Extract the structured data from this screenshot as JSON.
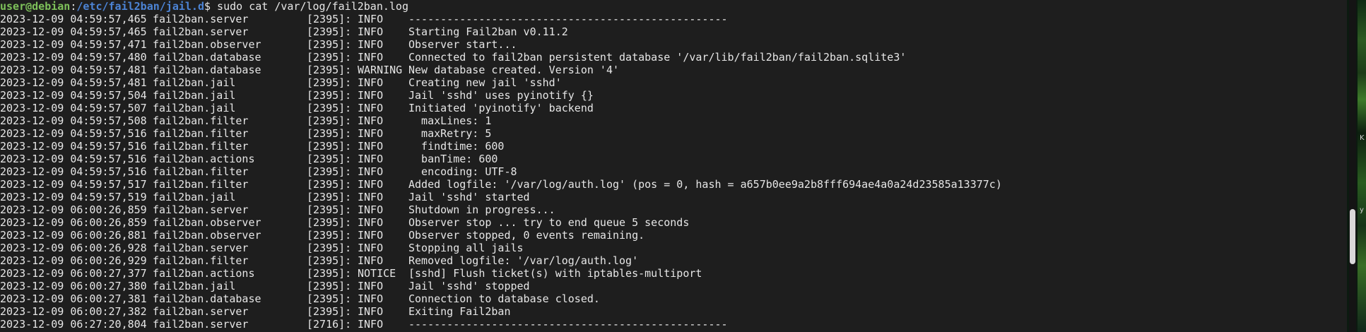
{
  "prompt": {
    "user": "user@debian",
    "separator": ":",
    "path": "/etc/fail2ban/jail.d",
    "dollar": "$",
    "command": " sudo cat /var/log/fail2ban.log"
  },
  "log": [
    {
      "ts": "2023-12-09 04:59:57,465",
      "logger": "fail2ban.server",
      "pid": "[2395]:",
      "level": "INFO",
      "msg": "--------------------------------------------------"
    },
    {
      "ts": "2023-12-09 04:59:57,465",
      "logger": "fail2ban.server",
      "pid": "[2395]:",
      "level": "INFO",
      "msg": "Starting Fail2ban v0.11.2"
    },
    {
      "ts": "2023-12-09 04:59:57,471",
      "logger": "fail2ban.observer",
      "pid": "[2395]:",
      "level": "INFO",
      "msg": "Observer start..."
    },
    {
      "ts": "2023-12-09 04:59:57,480",
      "logger": "fail2ban.database",
      "pid": "[2395]:",
      "level": "INFO",
      "msg": "Connected to fail2ban persistent database '/var/lib/fail2ban/fail2ban.sqlite3'"
    },
    {
      "ts": "2023-12-09 04:59:57,481",
      "logger": "fail2ban.database",
      "pid": "[2395]:",
      "level": "WARNING",
      "msg": "New database created. Version '4'"
    },
    {
      "ts": "2023-12-09 04:59:57,481",
      "logger": "fail2ban.jail",
      "pid": "[2395]:",
      "level": "INFO",
      "msg": "Creating new jail 'sshd'"
    },
    {
      "ts": "2023-12-09 04:59:57,504",
      "logger": "fail2ban.jail",
      "pid": "[2395]:",
      "level": "INFO",
      "msg": "Jail 'sshd' uses pyinotify {}"
    },
    {
      "ts": "2023-12-09 04:59:57,507",
      "logger": "fail2ban.jail",
      "pid": "[2395]:",
      "level": "INFO",
      "msg": "Initiated 'pyinotify' backend"
    },
    {
      "ts": "2023-12-09 04:59:57,508",
      "logger": "fail2ban.filter",
      "pid": "[2395]:",
      "level": "INFO",
      "msg": "  maxLines: 1"
    },
    {
      "ts": "2023-12-09 04:59:57,516",
      "logger": "fail2ban.filter",
      "pid": "[2395]:",
      "level": "INFO",
      "msg": "  maxRetry: 5"
    },
    {
      "ts": "2023-12-09 04:59:57,516",
      "logger": "fail2ban.filter",
      "pid": "[2395]:",
      "level": "INFO",
      "msg": "  findtime: 600"
    },
    {
      "ts": "2023-12-09 04:59:57,516",
      "logger": "fail2ban.actions",
      "pid": "[2395]:",
      "level": "INFO",
      "msg": "  banTime: 600"
    },
    {
      "ts": "2023-12-09 04:59:57,516",
      "logger": "fail2ban.filter",
      "pid": "[2395]:",
      "level": "INFO",
      "msg": "  encoding: UTF-8"
    },
    {
      "ts": "2023-12-09 04:59:57,517",
      "logger": "fail2ban.filter",
      "pid": "[2395]:",
      "level": "INFO",
      "msg": "Added logfile: '/var/log/auth.log' (pos = 0, hash = a657b0ee9a2b8fff694ae4a0a24d23585a13377c)"
    },
    {
      "ts": "2023-12-09 04:59:57,519",
      "logger": "fail2ban.jail",
      "pid": "[2395]:",
      "level": "INFO",
      "msg": "Jail 'sshd' started"
    },
    {
      "ts": "2023-12-09 06:00:26,859",
      "logger": "fail2ban.server",
      "pid": "[2395]:",
      "level": "INFO",
      "msg": "Shutdown in progress..."
    },
    {
      "ts": "2023-12-09 06:00:26,859",
      "logger": "fail2ban.observer",
      "pid": "[2395]:",
      "level": "INFO",
      "msg": "Observer stop ... try to end queue 5 seconds"
    },
    {
      "ts": "2023-12-09 06:00:26,881",
      "logger": "fail2ban.observer",
      "pid": "[2395]:",
      "level": "INFO",
      "msg": "Observer stopped, 0 events remaining."
    },
    {
      "ts": "2023-12-09 06:00:26,928",
      "logger": "fail2ban.server",
      "pid": "[2395]:",
      "level": "INFO",
      "msg": "Stopping all jails"
    },
    {
      "ts": "2023-12-09 06:00:26,929",
      "logger": "fail2ban.filter",
      "pid": "[2395]:",
      "level": "INFO",
      "msg": "Removed logfile: '/var/log/auth.log'"
    },
    {
      "ts": "2023-12-09 06:00:27,377",
      "logger": "fail2ban.actions",
      "pid": "[2395]:",
      "level": "NOTICE",
      "msg": "[sshd] Flush ticket(s) with iptables-multiport"
    },
    {
      "ts": "2023-12-09 06:00:27,380",
      "logger": "fail2ban.jail",
      "pid": "[2395]:",
      "level": "INFO",
      "msg": "Jail 'sshd' stopped"
    },
    {
      "ts": "2023-12-09 06:00:27,381",
      "logger": "fail2ban.database",
      "pid": "[2395]:",
      "level": "INFO",
      "msg": "Connection to database closed."
    },
    {
      "ts": "2023-12-09 06:00:27,382",
      "logger": "fail2ban.server",
      "pid": "[2395]:",
      "level": "INFO",
      "msg": "Exiting Fail2ban"
    },
    {
      "ts": "2023-12-09 06:27:20,804",
      "logger": "fail2ban.server",
      "pid": "[2716]:",
      "level": "INFO",
      "msg": "--------------------------------------------------"
    }
  ],
  "side": {
    "letter_top": "K",
    "letter_bottom": "y"
  },
  "colors": {
    "background": "#1e1e1e",
    "text": "#e6e6e6",
    "prompt_user": "#7ec15a",
    "prompt_path": "#4c84d6"
  }
}
